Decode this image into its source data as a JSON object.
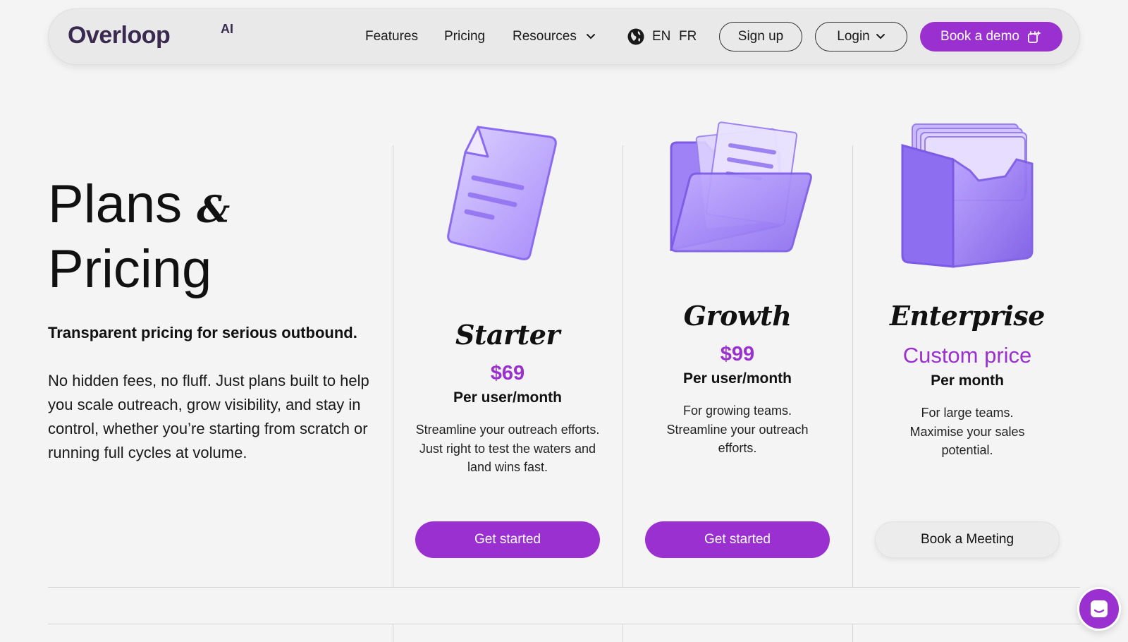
{
  "nav": {
    "logo": "Overloop",
    "logo_suffix": "AI",
    "links": [
      "Features",
      "Pricing",
      "Resources"
    ],
    "languages": [
      "EN",
      "FR"
    ],
    "signup_label": "Sign up",
    "login_label": "Login",
    "demo_label": "Book a demo"
  },
  "hero": {
    "title_line1": "Plans",
    "title_amp": "&",
    "title_line2": "Pricing",
    "lead": "Transparent pricing for serious outbound.",
    "body": "No hidden fees, no fluff. Just plans built to help you scale outreach, grow visibility, and stay in control, whether you’re starting from scratch or running full cycles at volume."
  },
  "plans": [
    {
      "name": "Starter",
      "price": "$69",
      "period": "Per user/month",
      "description": "Streamline your outreach efforts. Just right to test the waters and land wins fast.",
      "cta": "Get started",
      "illustration": "document-icon"
    },
    {
      "name": "Growth",
      "price": "$99",
      "period": "Per user/month",
      "description": "For growing teams. Streamline your outreach efforts.",
      "cta": "Get started",
      "illustration": "folder-icon"
    },
    {
      "name": "Enterprise",
      "price": "Custom price",
      "period": "Per month",
      "description": "For large teams. Maximise your sales potential.",
      "cta": "Book a Meeting",
      "illustration": "file-box-icon"
    }
  ],
  "colors": {
    "accent": "#9b30d0",
    "background": "#f4f4f4",
    "illustration": "#a78bfa"
  }
}
